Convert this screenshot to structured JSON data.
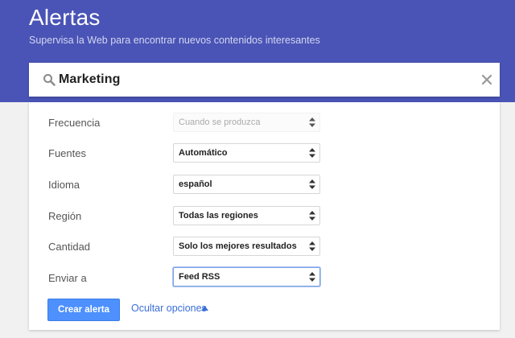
{
  "header": {
    "title": "Alertas",
    "subtitle": "Supervisa la Web para encontrar nuevos contenidos interesantes",
    "background_color": "#4a54b6"
  },
  "search": {
    "value": "Marketing",
    "search_icon": "search-icon",
    "clear_icon": "close-icon"
  },
  "options": [
    {
      "label": "Frecuencia",
      "value": "Cuando se produzca",
      "disabled": true
    },
    {
      "label": "Fuentes",
      "value": "Automático"
    },
    {
      "label": "Idioma",
      "value": "español"
    },
    {
      "label": "Región",
      "value": "Todas las regiones"
    },
    {
      "label": "Cantidad",
      "value": "Solo los mejores resultados"
    },
    {
      "label": "Enviar a",
      "value": "Feed RSS",
      "focused": true
    }
  ],
  "actions": {
    "create_label": "Crear alerta",
    "hide_options_label": "Ocultar opciones",
    "hide_options_icon": "caret-up-icon",
    "create_color": "#4d90fe",
    "link_color": "#3b6fd8"
  }
}
